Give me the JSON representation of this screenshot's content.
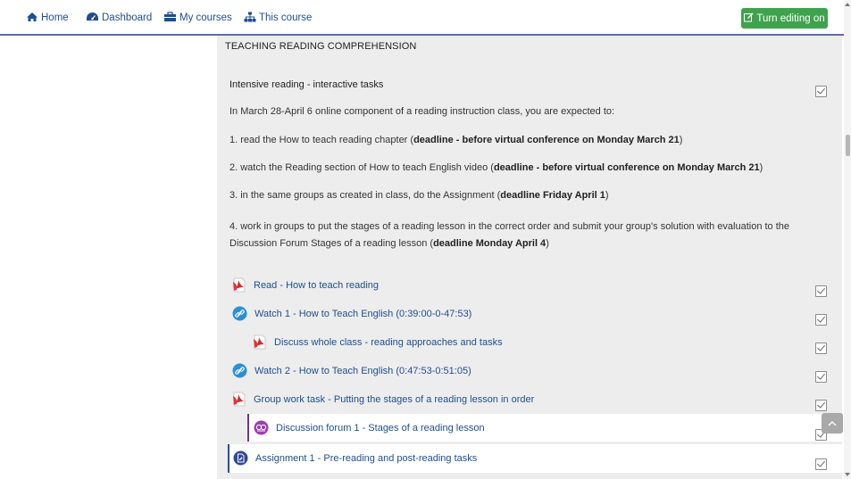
{
  "nav": {
    "home": "Home",
    "dashboard": "Dashboard",
    "my_courses": "My courses",
    "this_course": "This course",
    "edit_button": "Turn editing on"
  },
  "section": {
    "title": "TEACHING READING COMPREHENSION",
    "intro_title": "Intensive reading - interactive tasks",
    "intro_line": "In March 28-April 6 online component of a reading instruction class, you are expected to:",
    "items": [
      {
        "pre": "1. read the How to teach reading chapter (",
        "bold": "deadline - before virtual conference on Monday March 21",
        "post": ")"
      },
      {
        "pre": "2. watch the Reading section of How to teach English video (",
        "bold": "deadline - before virtual conference on Monday March 21",
        "post": ")"
      },
      {
        "pre": "3. in the same groups as created in class, do the Assignment (",
        "bold": "deadline Friday April 1",
        "post": ")"
      },
      {
        "pre": "4. work in groups to put the stages of a reading lesson in the correct order and submit your group's solution with evaluation to the Discussion Forum Stages of a reading lesson (",
        "bold": "deadline Monday April 4",
        "post": ")"
      }
    ]
  },
  "activities": [
    {
      "label": "Read - How to teach reading",
      "icon": "pdf-icon"
    },
    {
      "label": "Watch 1 - How to Teach English (0:39:00-0-47:53)",
      "icon": "url-link-icon"
    },
    {
      "label": "Discuss whole class - reading approaches and tasks",
      "icon": "pdf-icon"
    },
    {
      "label": "Watch 2 - How to Teach English (0:47:53-0:51:05)",
      "icon": "url-link-icon"
    },
    {
      "label": "Group work task - Putting the stages of a reading lesson in order",
      "icon": "pdf-icon"
    },
    {
      "label": "Discussion forum 1 - Stages of a reading lesson",
      "icon": "forum-icon"
    },
    {
      "label": "Assignment 1 - Pre-reading and post-reading tasks",
      "icon": "assignment-icon"
    }
  ],
  "colors": {
    "link": "#1f4e8f",
    "edit_button": "#3fa34d",
    "forum_accent": "#7a2e8e",
    "assignment_accent": "#2f4a9c",
    "pdf_red": "#d9262b"
  }
}
